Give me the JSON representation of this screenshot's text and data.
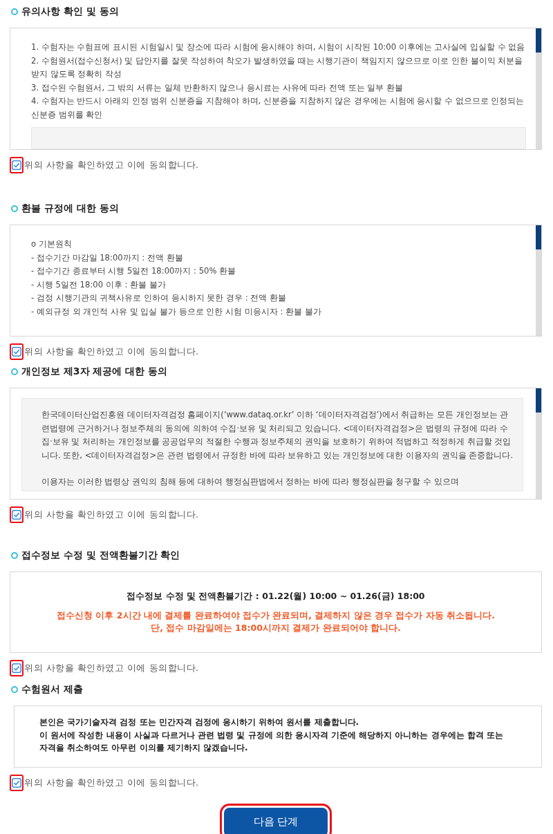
{
  "sections": [
    {
      "title": "유의사항 확인 및 동의",
      "kind": "scroll",
      "inner_panel": false,
      "trailing_panel": true,
      "lines": [
        "1. 수험자는 수험표에 표시된 시험일시 및 장소에 따라 시험에 응시해야 하며, 시험이 시작된 10:00 이후에는 고사실에 입실할 수 없음",
        "2. 수험원서(접수신청서) 및 답안지를 잘못 작성하여 착오가 발생하였을 때는 시행기관이 책임지지 않으므로 이로 인한 불이익 처분을 받지 않도록 정확히 작성",
        "3. 접수된 수험원서, 그 밖의 서류는 일체 반환하지 않으나 응시료는 사유에 따라 전액 또는 일부 환불",
        "4. 수험자는 반드시 아래의 인정 범위 신분증을 지참해야 하며, 신분증을 지참하지 않은 경우에는 시험에 응시할 수 없으므로 인정되는 신분증 범위를 확인"
      ],
      "agreement": {
        "label": "위의 사항을 확인하였고 이에 동의합니다.",
        "checked": true,
        "highlighted": true
      }
    },
    {
      "title": "환불 규정에 대한 동의",
      "kind": "scroll",
      "inner_panel": false,
      "trailing_panel": false,
      "lines": [
        "o 기본원칙",
        "- 접수기간 마감일 18:00까지 : 전액 환불",
        "- 접수기간 종료부터 시행 5일전 18:00까지 : 50% 환불",
        "- 시행 5일전 18:00 이후 : 환불 불가",
        "- 검정 시행기관의 귀책사유로 인하여 응시하지 못한 경우 : 전액 환불",
        "- 예외규정 외 개인적 사유 및 입실 불가 등으로 인한 시험 미응시자 : 환불 불가"
      ],
      "agreement": {
        "label": "위의 사항을 확인하였고 이에 동의합니다.",
        "checked": true,
        "highlighted": true
      }
    },
    {
      "title": "개인정보 제3자 제공에 대한 동의",
      "kind": "scroll",
      "inner_panel": true,
      "trailing_panel": false,
      "lines": [
        "한국데이터산업진흥원 데이터자격검정 홈페이지(‘www.dataq.or.kr’ 이하 ‘데이터자격검정’)에서 취급하는 모든 개인정보는 관련법령에 근거하거나 정보주체의 동의에 의하여 수집·보유 및 처리되고 있습니다. <데이터자격검정>은 법령의 규정에 따라 수집·보유 및 처리하는 개인정보를 공공업무의 적절한 수행과 정보주체의 권익을 보호하기 위하여 적법하고 적정하게 취급할 것입니다. 또한, <데이터자격검정>은 관련 법령에서 규정한 바에 따라 보유하고 있는 개인정보에 대한 이용자의 권익을 존중합니다.",
        "이용자는 이러한 법령상 권익의 침해 등에 대하여 행정심판법에서 정하는 바에 따라 행정심판을 청구할 수 있으며"
      ],
      "agreement": {
        "label": "위의 사항을 확인하였고 이에 동의합니다.",
        "checked": true,
        "highlighted": true
      }
    },
    {
      "title": "접수정보 수정 및 전액환불기간 확인",
      "kind": "notice",
      "lines": [
        {
          "kind": "period",
          "text": "접수정보 수정 및 전액환불기간 : 01.22(월) 10:00 ~ 01.26(금) 18:00"
        },
        {
          "kind": "warning",
          "text": "접수신청 이후 2시간 내에 결제를 완료하여야 접수가 완료되며, 결제하지 않은 경우 접수가 자동 취소됩니다."
        },
        {
          "kind": "warning",
          "text": "단, 접수 마감일에는 18:00시까지 결제가 완료되어야 합니다."
        }
      ],
      "agreement": {
        "label": "위의 사항을 확인하였고 이에 동의합니다.",
        "checked": true,
        "highlighted": true
      }
    },
    {
      "title": "수험원서 제출",
      "kind": "statement",
      "lines": [
        "본인은 국가기술자격 검정 또는 민간자격 검정에 응시하기 위하여 원서를 제출합니다.",
        "이 원서에 작성한 내용이 사실과 다르거나 관련 법령 및 규정에 의한 응시자격 기준에 해당하지 아니하는 경우에는 합격 또는 자격을 취소하여도 아무런 이의를 제기하지 않겠습니다."
      ],
      "agreement": {
        "label": "위의 사항을 확인하였고 이에 동의합니다.",
        "checked": true,
        "highlighted": true
      }
    }
  ],
  "next_button": {
    "label": "다음 단계",
    "highlighted": true
  }
}
